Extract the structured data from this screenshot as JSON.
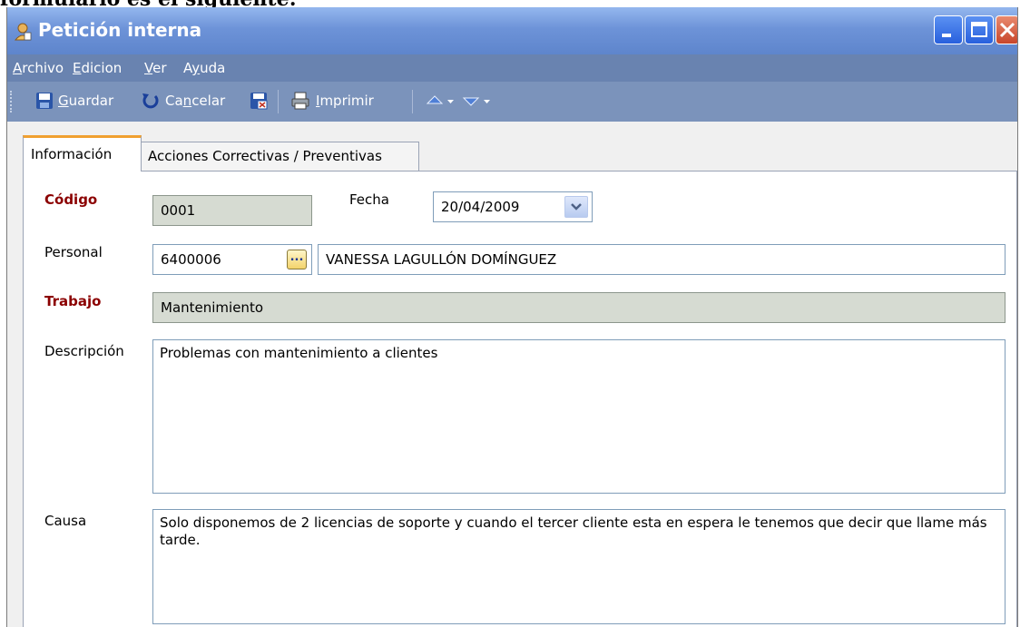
{
  "page": {
    "top_caption": "formulario es el siguiente:"
  },
  "window": {
    "title": "Petición interna",
    "title_icon": "user-form-icon",
    "controls": [
      "minimize-icon",
      "maximize-icon",
      "close-icon"
    ]
  },
  "menubar": {
    "items": [
      {
        "label": "Archivo",
        "accel": "A",
        "rest": "rchivo"
      },
      {
        "label": "Edicion",
        "accel": "E",
        "rest": "dicion"
      },
      {
        "label": "Ver",
        "accel": "V",
        "rest": "er"
      },
      {
        "label": "Ayuda",
        "pre": "A",
        "accel": "y",
        "rest": "uda"
      }
    ]
  },
  "toolbar": {
    "save_label_accel": "G",
    "save_label_rest": "uardar",
    "cancel_label_pre": "Ca",
    "cancel_label_accel": "n",
    "cancel_label_rest": "celar",
    "print_label_accel": "I",
    "print_label_rest": "mprimir",
    "icons": [
      "save-icon",
      "undo-icon",
      "save-close-icon",
      "print-icon",
      "previous-icon",
      "next-icon"
    ]
  },
  "tabs": [
    {
      "label": "Información",
      "active": true
    },
    {
      "label": "Acciones Correctivas / Preventivas",
      "active": false
    }
  ],
  "form": {
    "codigo_label": "Código",
    "codigo_value": "0001",
    "fecha_label": "Fecha",
    "fecha_value": "20/04/2009",
    "personal_label": "Personal",
    "personal_code": "6400006",
    "personal_lookup": "...",
    "personal_name": "VANESSA LAGULLÓN DOMÍNGUEZ",
    "trabajo_label": "Trabajo",
    "trabajo_value": "Mantenimiento",
    "descripcion_label": "Descripción",
    "descripcion_value": "Problemas con mantenimiento a clientes",
    "causa_label": "Causa",
    "causa_value": "Solo disponemos de 2 licencias de soporte y cuando el tercer cliente esta en espera le tenemos que decir que llame más tarde."
  },
  "colors": {
    "title_bar": "#6d93d8",
    "menubar": "#6983b0",
    "toolbar": "#7b93bb",
    "required_label": "#8b0000",
    "readonly_field": "#d6dbd2",
    "active_tab_accent": "#f0a030"
  }
}
